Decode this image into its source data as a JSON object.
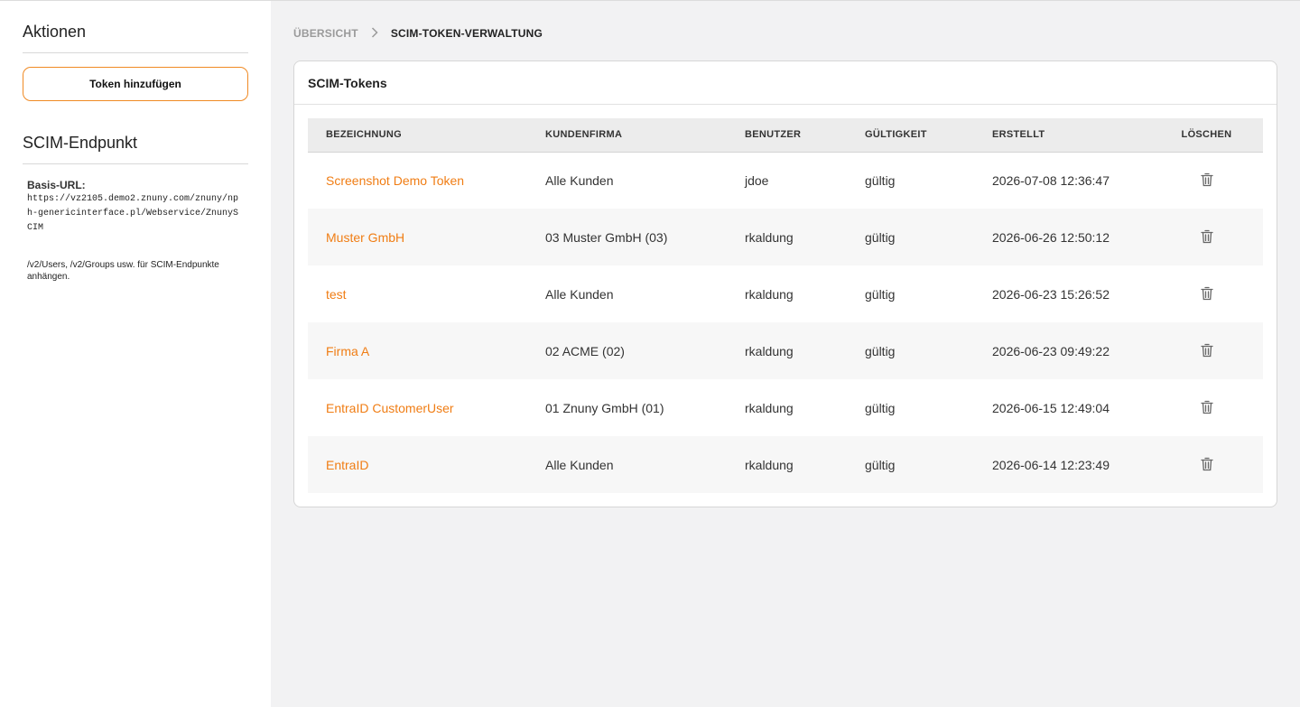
{
  "sidebar": {
    "actions_heading": "Aktionen",
    "add_button_label": "Token hinzufügen",
    "endpoint_heading": "SCIM-Endpunkt",
    "base_url_label": "Basis-URL:",
    "base_url": "https://vz2105.demo2.znuny.com/znuny/nph-genericinterface.pl/Webservice/ZnunySCIM",
    "note": "/v2/Users, /v2/Groups usw. für SCIM-Endpunkte anhängen."
  },
  "breadcrumb": {
    "home": "ÜBERSICHT",
    "current": "SCIM-TOKEN-VERWALTUNG"
  },
  "card": {
    "title": "SCIM-Tokens",
    "columns": [
      "BEZEICHNUNG",
      "KUNDENFIRMA",
      "BENUTZER",
      "GÜLTIGKEIT",
      "ERSTELLT",
      "LÖSCHEN"
    ],
    "rows": [
      {
        "name": "Screenshot Demo Token",
        "company": "Alle Kunden",
        "user": "jdoe",
        "validity": "gültig",
        "created": "2026-07-08 12:36:47"
      },
      {
        "name": "Muster GmbH",
        "company": "03 Muster GmbH (03)",
        "user": "rkaldung",
        "validity": "gültig",
        "created": "2026-06-26 12:50:12"
      },
      {
        "name": "test",
        "company": "Alle Kunden",
        "user": "rkaldung",
        "validity": "gültig",
        "created": "2026-06-23 15:26:52"
      },
      {
        "name": "Firma A",
        "company": "02 ACME (02)",
        "user": "rkaldung",
        "validity": "gültig",
        "created": "2026-06-23 09:49:22"
      },
      {
        "name": "EntraID CustomerUser",
        "company": "01 Znuny GmbH (01)",
        "user": "rkaldung",
        "validity": "gültig",
        "created": "2026-06-15 12:49:04"
      },
      {
        "name": "EntraID",
        "company": "Alle Kunden",
        "user": "rkaldung",
        "validity": "gültig",
        "created": "2026-06-14 12:23:49"
      }
    ]
  },
  "colors": {
    "accent": "#f07d14",
    "button_border": "#f08a24",
    "page_background": "#f2f2f3"
  },
  "icons": {
    "breadcrumb_separator": "chevron-right-icon",
    "delete": "trash-icon"
  }
}
